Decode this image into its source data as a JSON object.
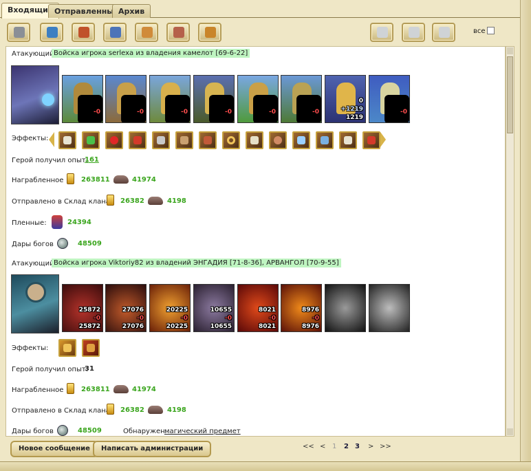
{
  "tabs": [
    {
      "label": "Входящие"
    },
    {
      "label": "Отправленные"
    },
    {
      "label": "Архив"
    }
  ],
  "toolbar": {
    "icons_left": [
      "scroll-icon",
      "quill-icon",
      "swords-icon",
      "book-icon",
      "people-icon",
      "hammer-icon",
      "warrior-icon"
    ],
    "icons_right": [
      "envelope-icon",
      "card-icon",
      "trash-icon"
    ],
    "all_label": "все"
  },
  "report1": {
    "attacker_label": "Атакующий",
    "attacker_text": "Войска игрока serlexa из владения камелот [69-6-22]",
    "units": [
      {
        "loss": "-0",
        "count": ""
      },
      {
        "loss": "-0",
        "count": ""
      },
      {
        "loss": "-0",
        "count": ""
      },
      {
        "loss": "-0",
        "count": ""
      },
      {
        "loss": "-0",
        "count": ""
      },
      {
        "loss": "-0",
        "count": ""
      },
      {
        "top": "0",
        "loss": "+1219",
        "count": "1219"
      },
      {
        "loss": "-0",
        "count": ""
      }
    ],
    "effects_label": "Эффекты:",
    "exp_label": "Герой получил опыт:",
    "exp_value": "161",
    "loot_label": "Награбленное",
    "gold": "263811",
    "ore": "41974",
    "clan_label": "Отправлено в Склад клана",
    "clan_gold": "26382",
    "clan_ore": "4198",
    "captives_label": "Пленные:",
    "captives": "24394",
    "gifts_label": "Дары богов",
    "gifts": "48509"
  },
  "report2": {
    "attacker_label": "Атакующий",
    "attacker_text": "Войска игрока Viktoriy82 из владений ЭНГАДИЯ [71-8-36], АРВАНГОЛ [70-9-55]",
    "units": [
      {
        "top": "25872",
        "loss": "-0",
        "count": "25872"
      },
      {
        "top": "27076",
        "loss": "-0",
        "count": "27076"
      },
      {
        "top": "20225",
        "loss": "-0",
        "count": "20225"
      },
      {
        "top": "10655",
        "loss": "-0",
        "count": "10655"
      },
      {
        "top": "8021",
        "loss": "-0",
        "count": "8021"
      },
      {
        "top": "8976",
        "loss": "-0",
        "count": "8976"
      },
      {
        "top": "",
        "loss": "",
        "count": ""
      },
      {
        "top": "",
        "loss": "",
        "count": ""
      }
    ],
    "effects_label": "Эффекты:",
    "exp_label": "Герой получил опыт:",
    "exp_value": "31",
    "loot_label": "Награбленное",
    "gold": "263811",
    "ore": "41974",
    "clan_label": "Отправлено в Склад клана",
    "clan_gold": "26382",
    "clan_ore": "4198",
    "gifts_label": "Дары богов",
    "gifts": "48509",
    "found_label": "Обнаружен",
    "found_link": "магический предмет"
  },
  "footer": {
    "new_message": "Новое сообщение",
    "write_admin": "Написать администрации",
    "pager": {
      "first": "<<",
      "prev": "<",
      "p1": "1",
      "p2": "2",
      "p3": "3",
      "next": ">",
      "last": ">>"
    }
  },
  "colors": {
    "accent_green": "#3aa51d",
    "highlight": "#bff5c1"
  }
}
